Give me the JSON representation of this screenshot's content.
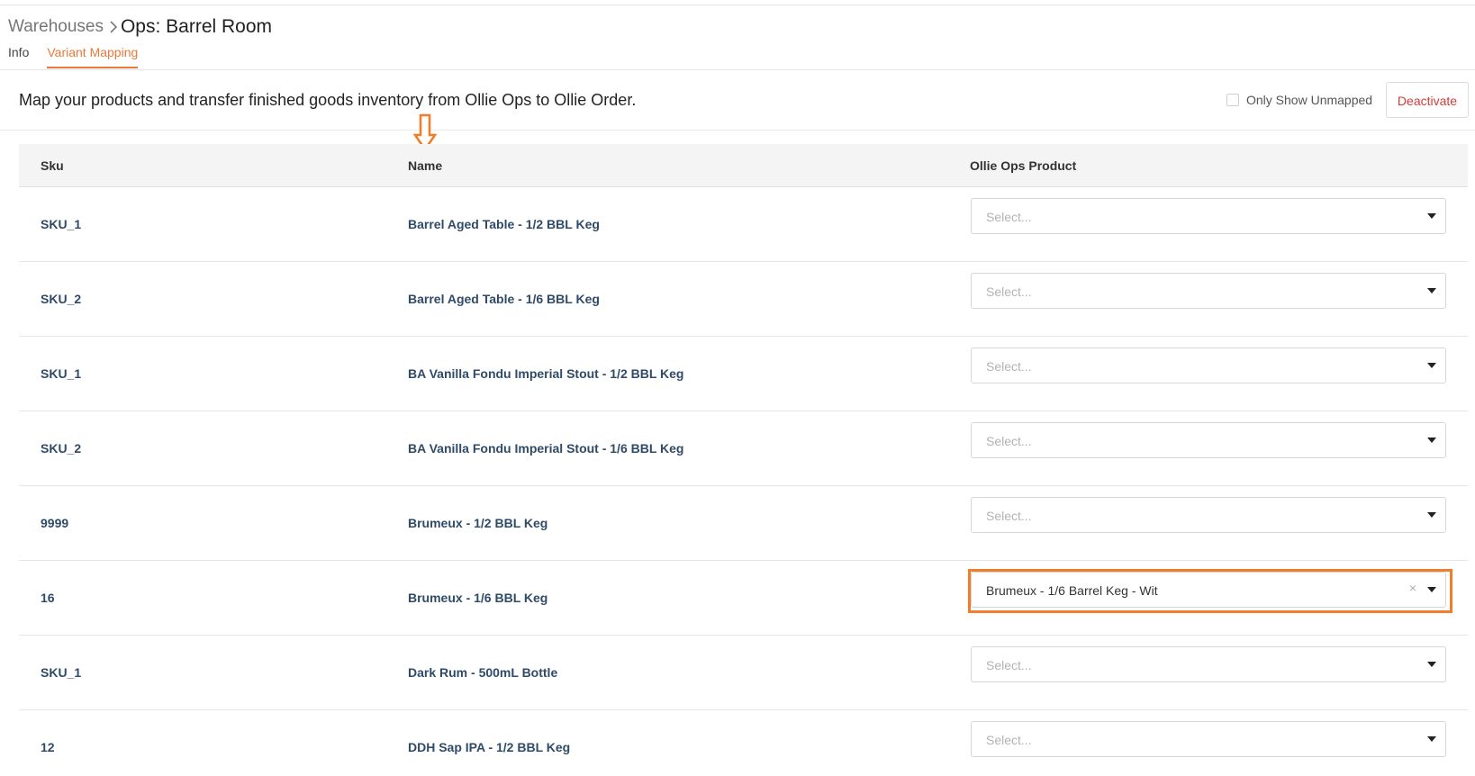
{
  "breadcrumb": {
    "parent": "Warehouses",
    "separator_icon": "chevron-right-icon",
    "current": "Ops: Barrel Room"
  },
  "tabs": [
    {
      "label": "Info",
      "active": false
    },
    {
      "label": "Variant Mapping",
      "active": true
    }
  ],
  "intro_text": "Map your products and transfer finished goods inventory from Ollie Ops to Ollie Order.",
  "filter": {
    "label": "Only Show Unmapped",
    "checked": false
  },
  "actions": {
    "deactivate_label": "Deactivate"
  },
  "colors": {
    "accent": "#e8793b",
    "danger": "#d43a3a",
    "link_text": "#2f4b67",
    "highlight": "#ef7d2c"
  },
  "table": {
    "columns": [
      "Sku",
      "Name",
      "Ollie Ops Product"
    ],
    "select_placeholder": "Select...",
    "rows": [
      {
        "sku": "SKU_1",
        "name": "Barrel Aged Table - 1/2 BBL Keg",
        "product": ""
      },
      {
        "sku": "SKU_2",
        "name": "Barrel Aged Table - 1/6 BBL Keg",
        "product": ""
      },
      {
        "sku": "SKU_1",
        "name": "BA Vanilla Fondu Imperial Stout - 1/2 BBL Keg",
        "product": ""
      },
      {
        "sku": "SKU_2",
        "name": "BA Vanilla Fondu Imperial Stout - 1/6 BBL Keg",
        "product": ""
      },
      {
        "sku": "9999",
        "name": "Brumeux - 1/2 BBL Keg",
        "product": ""
      },
      {
        "sku": "16",
        "name": "Brumeux - 1/6 BBL Keg",
        "product": "Brumeux - 1/6 Barrel Keg - Wit",
        "highlighted": true
      },
      {
        "sku": "SKU_1",
        "name": "Dark Rum - 500mL Bottle",
        "product": ""
      },
      {
        "sku": "12",
        "name": "DDH Sap IPA - 1/2 BBL Keg",
        "product": ""
      }
    ]
  }
}
